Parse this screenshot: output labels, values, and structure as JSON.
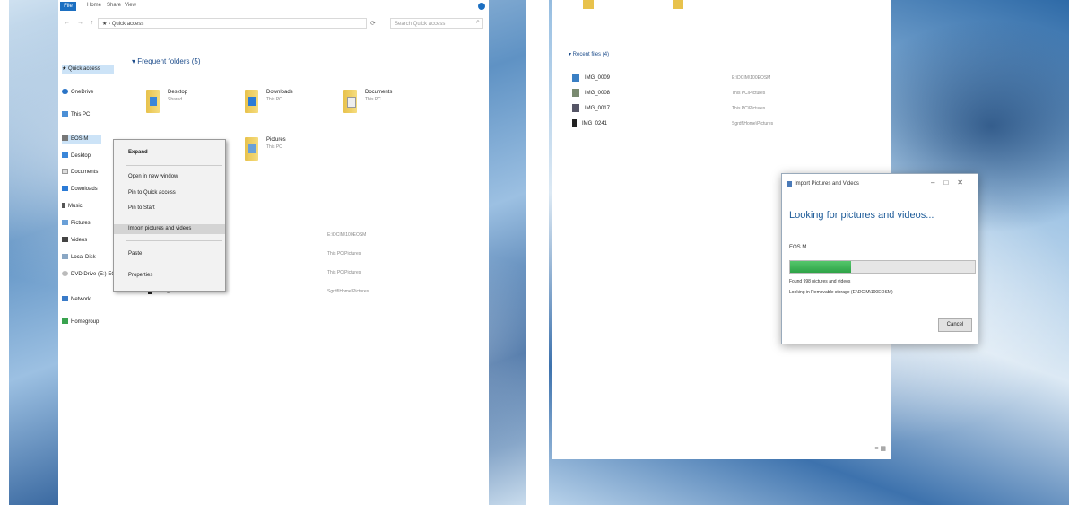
{
  "left": {
    "ribbon": {
      "file_tab": "File",
      "tabs": [
        "Home",
        "Share",
        "View"
      ]
    },
    "address": {
      "nav_arrows": "← → ↑",
      "path": "★ › Quick access",
      "search_placeholder": "Search Quick access"
    },
    "frequent_header": "▾ Frequent folders (5)",
    "nav_items": [
      {
        "label": "★ Quick access",
        "selected": true
      },
      {
        "label": "OneDrive"
      },
      {
        "label": "This PC"
      },
      {
        "label": "EOS M"
      },
      {
        "label": "Desktop"
      },
      {
        "label": "Documents"
      },
      {
        "label": "Downloads"
      },
      {
        "label": "Music"
      },
      {
        "label": "Pictures"
      },
      {
        "label": "Videos"
      },
      {
        "label": "Local Disk"
      },
      {
        "label": "DVD Drive (E:) EOS"
      },
      {
        "label": "Network"
      },
      {
        "label": "Homegroup"
      }
    ],
    "folders": [
      {
        "name": "Desktop",
        "sub": "Shared"
      },
      {
        "name": "Downloads",
        "sub": "This PC"
      },
      {
        "name": "Documents",
        "sub": "This PC"
      },
      {
        "name": "Pictures",
        "sub": "This PC"
      }
    ],
    "context_menu": {
      "expand": "Expand",
      "open_new_window": "Open in new window",
      "pin_quick_access": "Pin to Quick access",
      "pin_start": "Pin to Start",
      "import": "Import pictures and videos",
      "paste": "Paste",
      "properties": "Properties"
    },
    "recent_paths": [
      "E:\\DCIM\\100EOSM",
      "This PC\\Pictures",
      "This PC\\Pictures",
      "Sgrdf\\Home\\Pictures"
    ],
    "recent_last_name": "IMG_0241"
  },
  "right": {
    "recent_header": "▾ Recent files (4)",
    "recent_items": [
      {
        "name": "IMG_0009",
        "path": "E:\\DCIM\\100EOSM"
      },
      {
        "name": "IMG_0008",
        "path": "This PC\\Pictures"
      },
      {
        "name": "IMG_0017",
        "path": "This PC\\Pictures"
      },
      {
        "name": "IMG_0241",
        "path": "Sgrdf\\Home\\Pictures"
      }
    ],
    "dialog": {
      "title": "Import Pictures and Videos",
      "heading": "Looking for pictures and videos...",
      "device": "EOS M",
      "progress": 0.33,
      "found": "Found 998 pictures and videos",
      "looking": "Looking in Removable storage (E:\\DCIM\\100EOSM)",
      "cancel": "Cancel"
    },
    "view_icons": "≡ ▦"
  },
  "colors": {
    "accent": "#1c6fc1",
    "progress": "#2ea347",
    "heading": "#1f5c99"
  }
}
